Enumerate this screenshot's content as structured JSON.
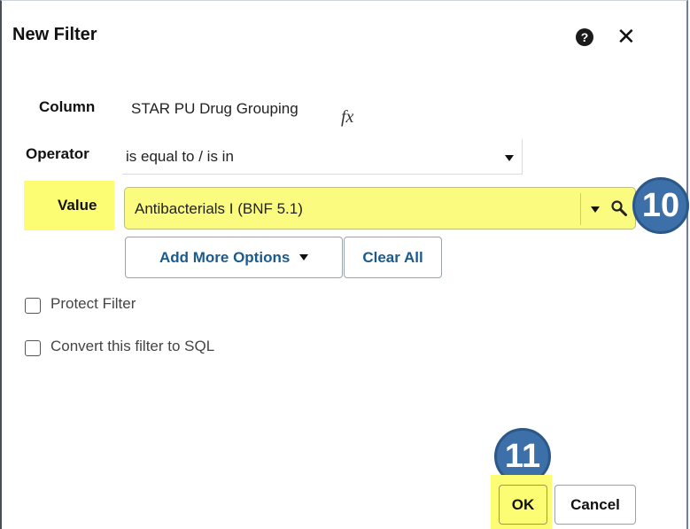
{
  "dialog": {
    "title": "New Filter",
    "help_icon": "question-circle-icon",
    "close_icon": "close-icon",
    "close_glyph": "✕"
  },
  "form": {
    "column_label": "Column",
    "column_value": "STAR PU Drug Grouping",
    "fx_glyph": "fx",
    "operator_label": "Operator",
    "operator_value": "is equal to / is in",
    "value_label": "Value",
    "value_value": "Antibacterials I (BNF 5.1)",
    "add_more_options_label": "Add More Options",
    "clear_all_label": "Clear All"
  },
  "options": {
    "protect_filter_label": "Protect Filter",
    "convert_sql_label": "Convert this filter to SQL"
  },
  "footer": {
    "ok_label": "OK",
    "cancel_label": "Cancel"
  },
  "annotations": {
    "step_10": "10",
    "step_11": "11",
    "highlight_color": "#fdfd73",
    "badge_color": "#3d6fa8"
  }
}
